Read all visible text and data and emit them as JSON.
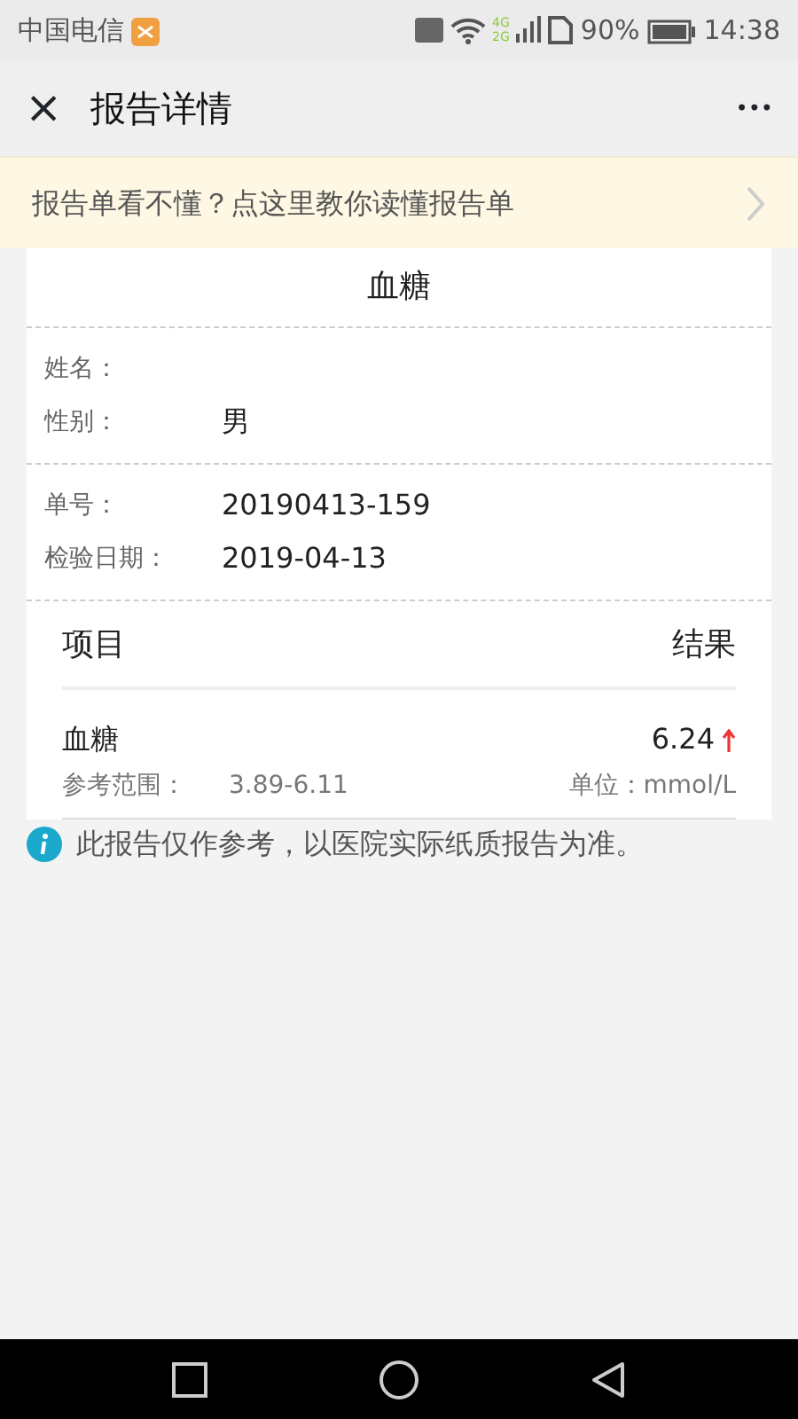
{
  "status_bar": {
    "carrier": "中国电信",
    "network": [
      "4G",
      "2G"
    ],
    "battery": "90%",
    "time": "14:38"
  },
  "header": {
    "close": "×",
    "title": "报告详情",
    "more": "•••"
  },
  "banner": {
    "text": "报告单看不懂？点这里教你读懂报告单"
  },
  "report": {
    "title": "血糖",
    "groups": [
      [
        {
          "label": "姓名："
        },
        {
          "label": "性别：",
          "value": "男"
        }
      ],
      [
        {
          "label": "单号：",
          "value": "20190413-159"
        },
        {
          "label": "检验日期：",
          "value": "2019-04-13"
        }
      ]
    ],
    "columns": [
      "项目",
      "结果"
    ],
    "items": [
      {
        "name": "血糖",
        "result": "6.24",
        "above_range": true,
        "range_label": "参考范围：",
        "range": "3.89-6.11",
        "unit": "单位：mmol/L"
      }
    ]
  },
  "note": "此报告仅作参考，以医院实际纸质报告为准。"
}
